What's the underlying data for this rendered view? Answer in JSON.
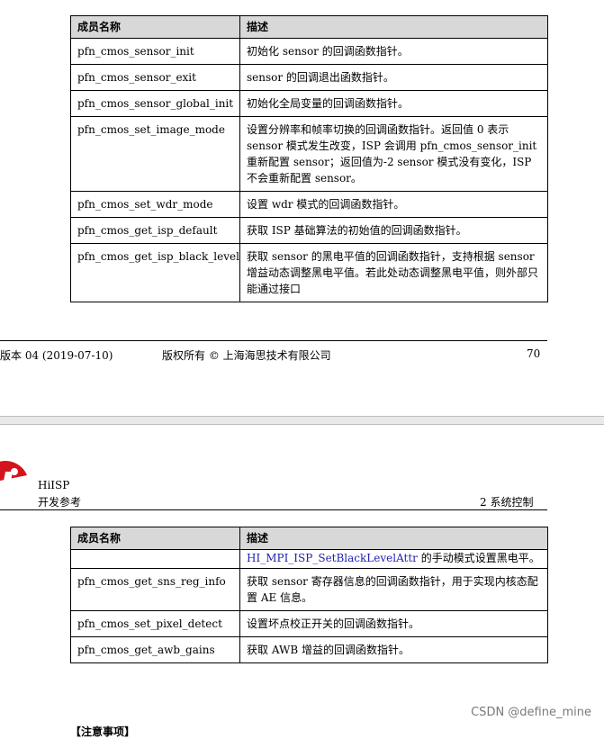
{
  "page1": {
    "table": {
      "headers": [
        "成员名称",
        "描述"
      ],
      "rows": [
        {
          "name": "pfn_cmos_sensor_init",
          "desc": "初始化 sensor 的回调函数指针。"
        },
        {
          "name": "pfn_cmos_sensor_exit",
          "desc": "sensor 的回调退出函数指针。"
        },
        {
          "name": "pfn_cmos_sensor_global_init",
          "desc": "初始化全局变量的回调函数指针。"
        },
        {
          "name": "pfn_cmos_set_image_mode",
          "desc": "设置分辨率和帧率切换的回调函数指针。返回值 0 表示 sensor 模式发生改变，ISP 会调用 pfn_cmos_sensor_init 重新配置 sensor；返回值为-2 sensor 模式没有变化，ISP 不会重新配置 sensor。"
        },
        {
          "name": "pfn_cmos_set_wdr_mode",
          "desc": "设置 wdr 模式的回调函数指针。"
        },
        {
          "name": "pfn_cmos_get_isp_default",
          "desc": "获取 ISP 基础算法的初始值的回调函数指针。"
        },
        {
          "name": "pfn_cmos_get_isp_black_level",
          "desc": "获取 sensor 的黑电平值的回调函数指针，支持根据 sensor 增益动态调整黑电平值。若此处动态调整黑电平值，则外部只能通过接口"
        }
      ]
    },
    "footer": {
      "version": "版本 04 (2019-07-10)",
      "copyright": "版权所有 © 上海海思技术有限公司",
      "page_number": "70"
    }
  },
  "page2": {
    "header": {
      "title": "HiISP",
      "subtitle": "开发参考",
      "section": "2 系统控制"
    },
    "table": {
      "headers": [
        "成员名称",
        "描述"
      ],
      "cont_link": "HI_MPI_ISP_SetBlackLevelAttr",
      "cont_text": " 的手动模式设置黑电平。",
      "rows": [
        {
          "name": "pfn_cmos_get_sns_reg_info",
          "desc": "获取 sensor 寄存器信息的回调函数指针，用于实现内核态配置 AE 信息。"
        },
        {
          "name": "pfn_cmos_set_pixel_detect",
          "desc": "设置坏点校正开关的回调函数指针。"
        },
        {
          "name": "pfn_cmos_get_awb_gains",
          "desc": "获取 AWB 增益的回调函数指针。"
        }
      ]
    },
    "note_label": "【注意事项】"
  },
  "watermark": "CSDN @define_mine"
}
